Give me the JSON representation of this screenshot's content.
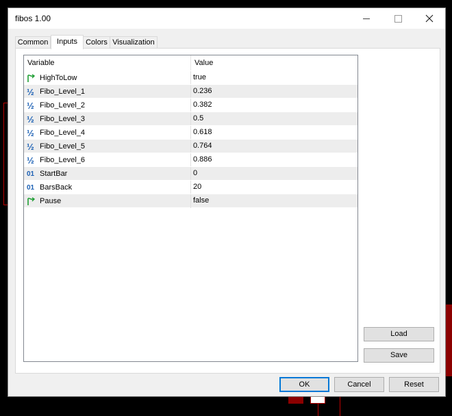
{
  "window": {
    "title": "fibos 1.00"
  },
  "tabs": [
    {
      "label": "Common"
    },
    {
      "label": "Inputs"
    },
    {
      "label": "Colors"
    },
    {
      "label": "Visualization"
    }
  ],
  "grid": {
    "columns": {
      "variable": "Variable",
      "value": "Value"
    },
    "rows": [
      {
        "icon": "boolean-flag-icon",
        "name": "HighToLow",
        "value": "true"
      },
      {
        "icon": "double-fraction-icon",
        "name": "Fibo_Level_1",
        "value": "0.236"
      },
      {
        "icon": "double-fraction-icon",
        "name": "Fibo_Level_2",
        "value": "0.382"
      },
      {
        "icon": "double-fraction-icon",
        "name": "Fibo_Level_3",
        "value": "0.5"
      },
      {
        "icon": "double-fraction-icon",
        "name": "Fibo_Level_4",
        "value": "0.618"
      },
      {
        "icon": "double-fraction-icon",
        "name": "Fibo_Level_5",
        "value": "0.764"
      },
      {
        "icon": "double-fraction-icon",
        "name": "Fibo_Level_6",
        "value": "0.886"
      },
      {
        "icon": "integer-icon",
        "name": "StartBar",
        "value": "0"
      },
      {
        "icon": "integer-icon",
        "name": "BarsBack",
        "value": "20"
      },
      {
        "icon": "boolean-flag-icon",
        "name": "Pause",
        "value": "false"
      }
    ]
  },
  "side_buttons": {
    "load": "Load",
    "save": "Save"
  },
  "dialog_buttons": {
    "ok": "OK",
    "cancel": "Cancel",
    "reset": "Reset"
  },
  "colors": {
    "focus_border": "#0078d7",
    "alt_row": "#ededed",
    "chart_red": "#8b0000"
  }
}
